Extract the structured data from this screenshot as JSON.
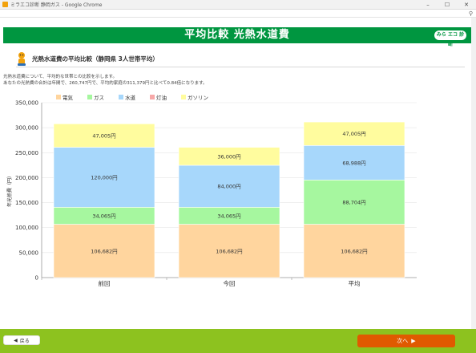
{
  "window": {
    "title": "ミラエコ診断 静岡ガス - Google Chrome",
    "min_glyph": "–",
    "max_glyph": "☐",
    "close_glyph": "✕"
  },
  "header": {
    "title": "平均比較 光熱水道費",
    "logo_text": "みら エコ 診断"
  },
  "subhead": {
    "title": "光熱水道費の平均比較（静岡県 3人世帯平均）"
  },
  "description": {
    "line1": "光熱水道費について、平均的な世帯との比較を示します。",
    "line2": "あなたの光熱費の合計は年間で、260,747円で、平均的家庭の311,379円と比べて0.84倍になります。"
  },
  "chart_data": {
    "type": "bar",
    "stacked": true,
    "categories": [
      "前回",
      "今回",
      "平均"
    ],
    "ylabel": "年光熱費（円）",
    "ylim": [
      0,
      350000
    ],
    "yticks": [
      "0",
      "50,000",
      "100,000",
      "150,000",
      "200,000",
      "250,000",
      "300,000",
      "350,000"
    ],
    "grid": true,
    "legend_position": "top-left",
    "series": [
      {
        "name": "電気",
        "color": "#ffd59e",
        "values": [
          106682,
          106682,
          106682
        ],
        "labels": [
          "106,682円",
          "106,682円",
          "106,682円"
        ]
      },
      {
        "name": "ガス",
        "color": "#a6f79f",
        "values": [
          34065,
          34065,
          88704
        ],
        "labels": [
          "34,065円",
          "34,065円",
          "88,704円"
        ]
      },
      {
        "name": "水道",
        "color": "#a7d7fb",
        "values": [
          120000,
          84000,
          68988
        ],
        "labels": [
          "120,000円",
          "84,000円",
          "68,988円"
        ]
      },
      {
        "name": "灯油",
        "color": "#f7a8a8",
        "values": [
          0,
          0,
          0
        ],
        "labels": [
          "",
          "",
          ""
        ]
      },
      {
        "name": "ガソリン",
        "color": "#fffc9e",
        "values": [
          47005,
          36000,
          47005
        ],
        "labels": [
          "47,005円",
          "36,000円",
          "47,005円"
        ]
      }
    ]
  },
  "footer": {
    "back_label": "戻る",
    "next_label": "次へ"
  },
  "colors": {
    "header_green": "#009640",
    "footer_green": "#8dc21f",
    "next_orange": "#e05a00"
  }
}
